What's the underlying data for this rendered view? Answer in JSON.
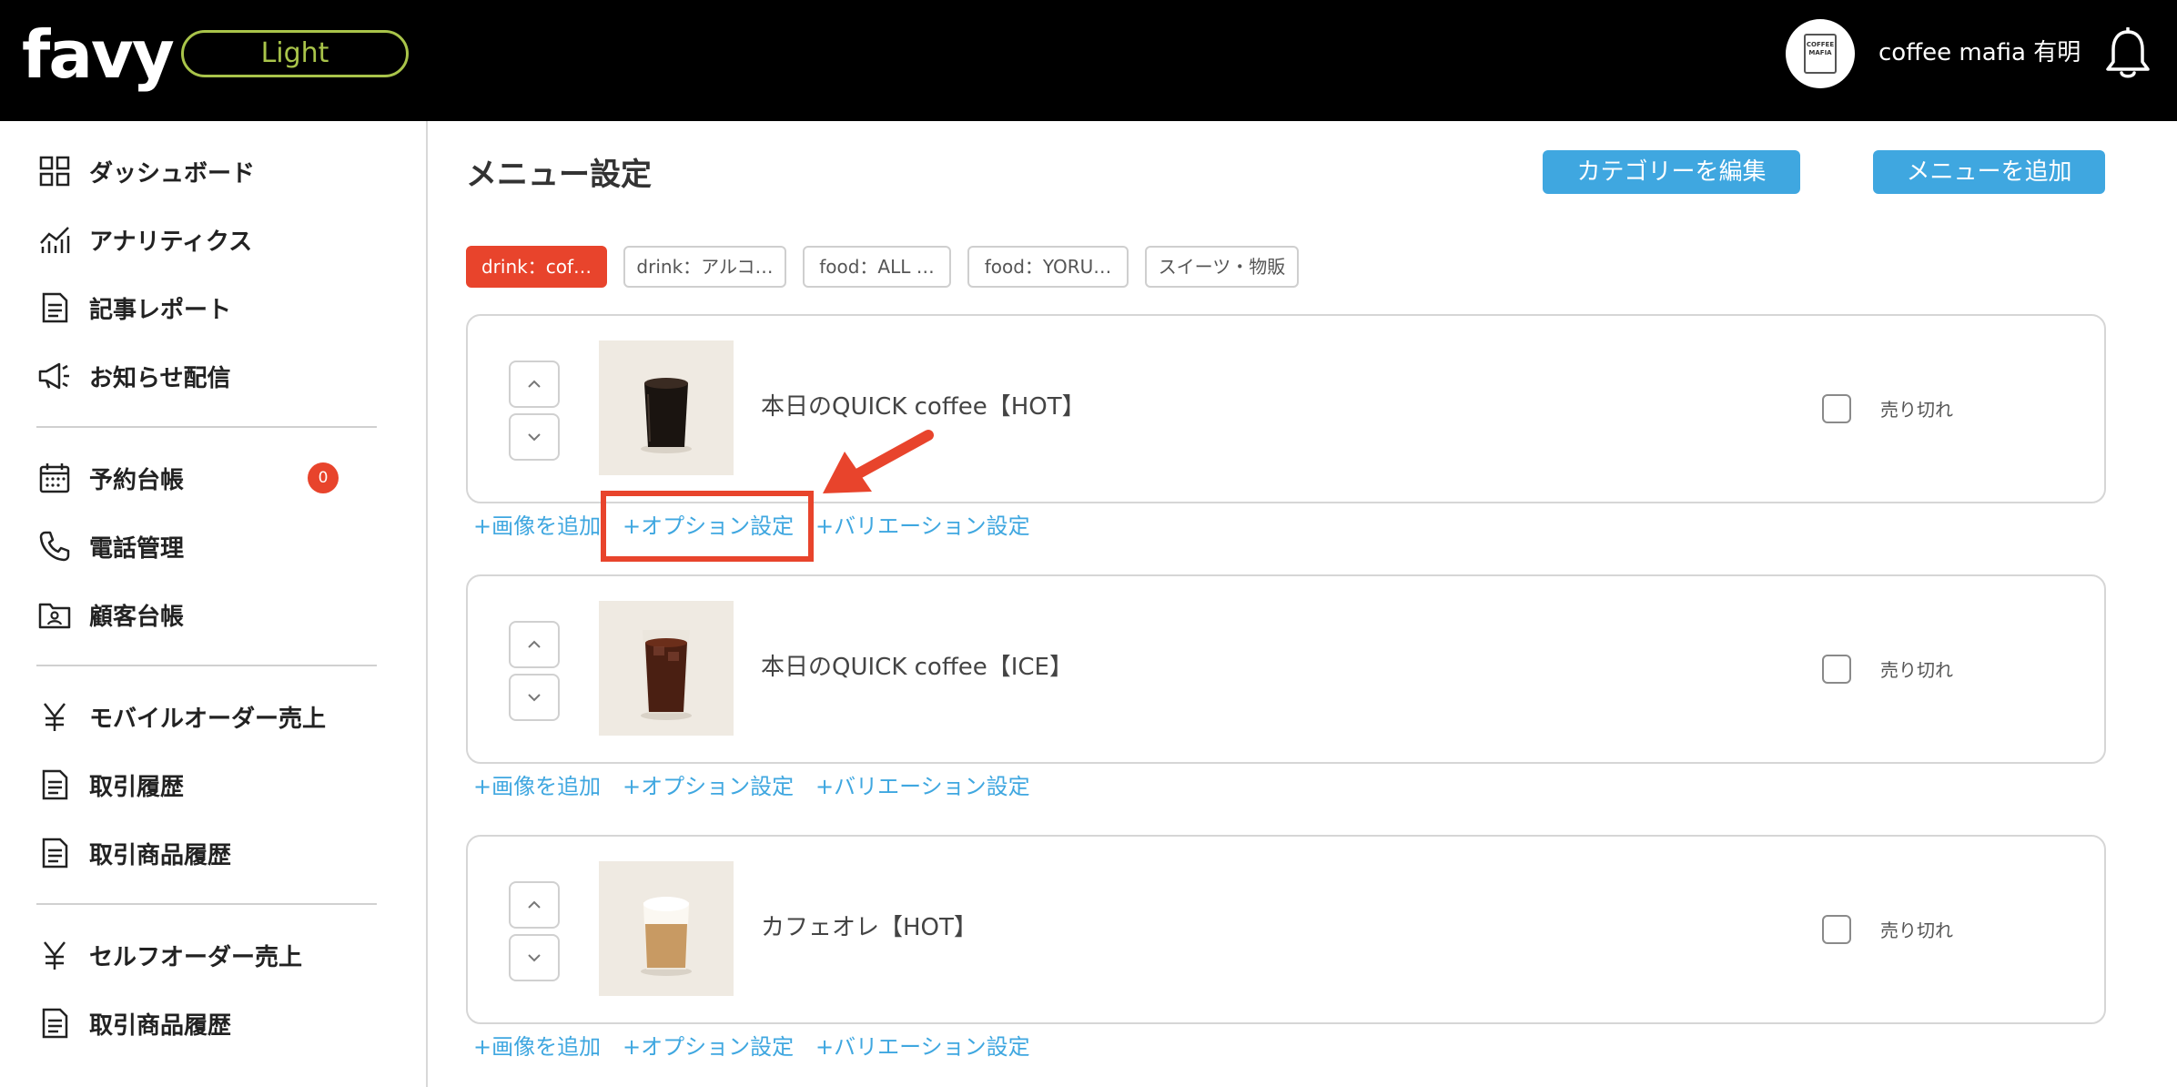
{
  "header": {
    "logo": "favy",
    "plan_badge": "Light",
    "avatar_text": "COFFEE MAFIA",
    "shop_name": "coffee mafia 有明",
    "bell_icon": "bell-icon"
  },
  "sidebar": {
    "items": [
      {
        "label": "ダッシュボード",
        "icon": "dashboard-grid-icon"
      },
      {
        "label": "アナリティクス",
        "icon": "analytics-chart-icon"
      },
      {
        "label": "記事レポート",
        "icon": "document-icon"
      },
      {
        "label": "お知らせ配信",
        "icon": "megaphone-icon"
      },
      {
        "label": "予約台帳",
        "icon": "calendar-icon",
        "badge": "0"
      },
      {
        "label": "電話管理",
        "icon": "phone-icon"
      },
      {
        "label": "顧客台帳",
        "icon": "customer-folder-icon"
      },
      {
        "label": "モバイルオーダー売上",
        "icon": "yen-icon"
      },
      {
        "label": "取引履歴",
        "icon": "document-icon"
      },
      {
        "label": "取引商品履歴",
        "icon": "document-icon"
      },
      {
        "label": "セルフオーダー売上",
        "icon": "yen-icon"
      },
      {
        "label": "取引商品履歴",
        "icon": "document-icon"
      }
    ]
  },
  "main": {
    "title": "メニュー設定",
    "edit_category_button": "カテゴリーを編集",
    "add_menu_button": "メニューを追加",
    "category_tabs": [
      {
        "label": "drink：cof…",
        "active": true
      },
      {
        "label": "drink：アルコ…",
        "active": false
      },
      {
        "label": "food：ALL …",
        "active": false
      },
      {
        "label": "food：YORU…",
        "active": false
      },
      {
        "label": "スイーツ・物販",
        "active": false
      }
    ],
    "items": [
      {
        "name": "本日のQUICK coffee【HOT】",
        "soldout_label": "売り切れ",
        "soldout_checked": false
      },
      {
        "name": "本日のQUICK coffee【ICE】",
        "soldout_label": "売り切れ",
        "soldout_checked": false
      },
      {
        "name": "カフェオレ【HOT】",
        "soldout_label": "売り切れ",
        "soldout_checked": false
      }
    ],
    "actions": {
      "add_image": "+画像を追加",
      "option_settings": "+オプション設定",
      "variation_settings": "+バリエーション設定"
    }
  },
  "colors": {
    "accent_blue": "#3fa7e0",
    "accent_red": "#e8442c",
    "plan_green": "#a9c44a",
    "header_bg": "#000000"
  }
}
